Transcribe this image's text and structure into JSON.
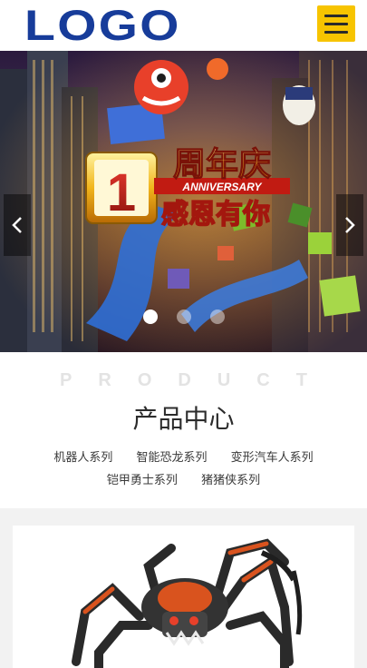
{
  "header": {
    "logo_text": "LOGO",
    "menu_icon": "hamburger-menu-icon",
    "accent_color": "#f7c400",
    "logo_color": "#173c9a"
  },
  "banner": {
    "badge_number": "1",
    "headline_top": "周年庆",
    "headline_sub": "ANNIVERSARY",
    "headline_bottom": "感恩有你",
    "prev_icon": "chevron-left-icon",
    "next_icon": "chevron-right-icon",
    "slide_count": 3,
    "active_slide": 1
  },
  "products": {
    "eyebrow": "PRODUCT",
    "title": "产品中心",
    "categories": [
      "机器人系列",
      "智能恐龙系列",
      "变形汽车人系列",
      "铠甲勇士系列",
      "猪猪侠系列"
    ]
  },
  "card": {
    "image_subject": "spider-robot-toy"
  }
}
